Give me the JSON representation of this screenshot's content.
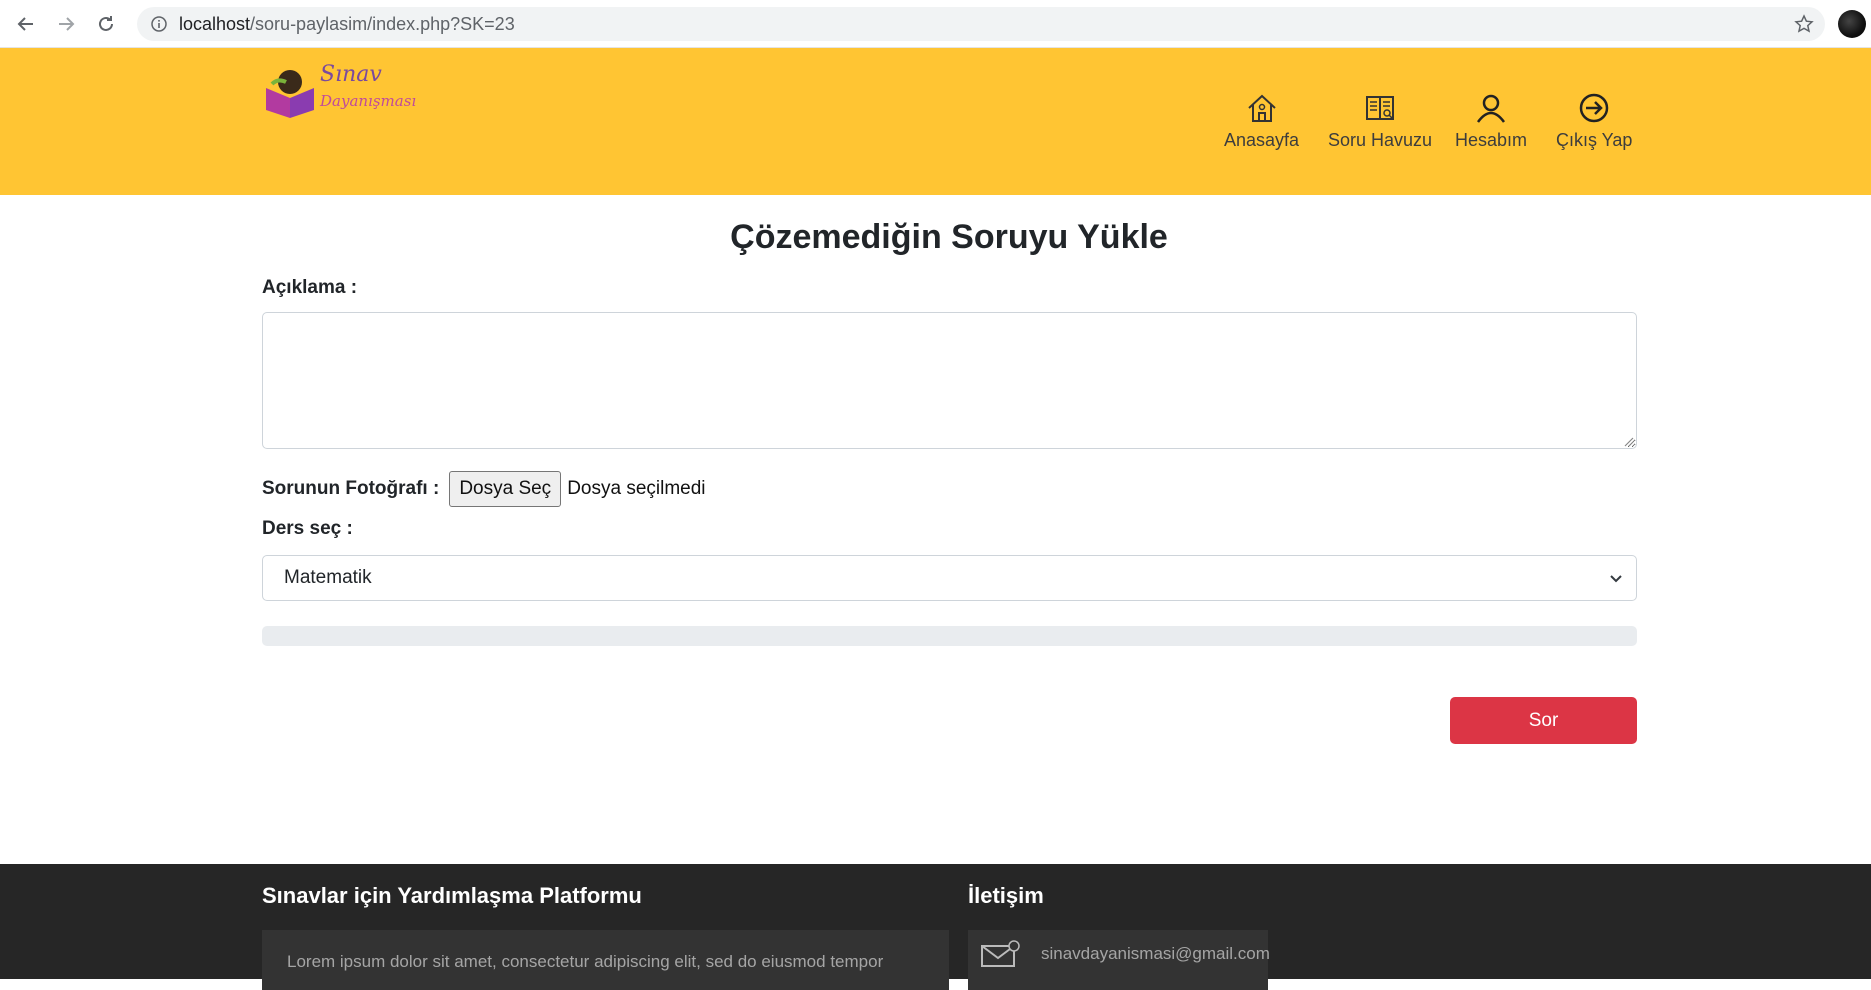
{
  "browser": {
    "url_host": "localhost",
    "url_path": "/soru-paylasim/index.php?SK=23"
  },
  "header": {
    "logo_line1": "Sınav",
    "logo_line2": "Dayanışması",
    "nav": [
      {
        "label": "Anasayfa",
        "icon": "home-icon"
      },
      {
        "label": "Soru Havuzu",
        "icon": "book-icon"
      },
      {
        "label": "Hesabım",
        "icon": "user-icon"
      },
      {
        "label": "Çıkış Yap",
        "icon": "logout-icon"
      }
    ]
  },
  "form": {
    "title": "Çözemediğin Soruyu Yükle",
    "description_label": "Açıklama :",
    "description_value": "",
    "photo_label": "Sorunun Fotoğrafı :",
    "file_button": "Dosya Seç",
    "file_status": "Dosya seçilmedi",
    "subject_label": "Ders seç :",
    "subject_selected": "Matematik",
    "upload_progress": 0,
    "submit_label": "Sor"
  },
  "footer": {
    "about_title": "Sınavlar için Yardımlaşma Platformu",
    "about_text": "Lorem ipsum dolor sit amet, consectetur adipiscing elit, sed do eiusmod tempor",
    "contact_title": "İletişim",
    "contact_email": "sinavdayanismasi@gmail.com"
  },
  "colors": {
    "header_bg": "#ffc533",
    "submit_bg": "#dc3545",
    "footer_bg": "#262626"
  }
}
